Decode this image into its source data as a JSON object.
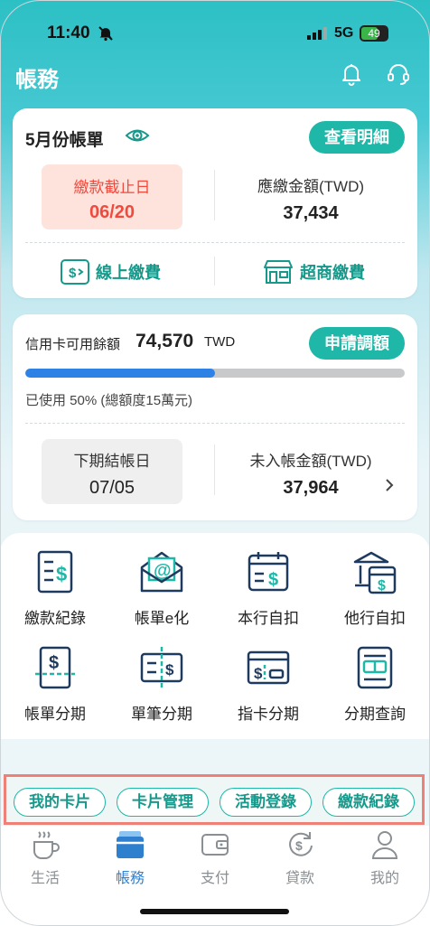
{
  "status_bar": {
    "time": "11:40",
    "network": "5G",
    "battery": "49"
  },
  "header": {
    "title": "帳務"
  },
  "bill": {
    "title": "5月份帳單",
    "detail_button": "查看明細",
    "due_label": "繳款截止日",
    "due_date": "06/20",
    "amount_label": "應繳金額(TWD)",
    "amount_value": "37,434",
    "online_pay": "線上繳費",
    "store_pay": "超商繳費"
  },
  "credit": {
    "available_label": "信用卡可用餘額",
    "available_value": "74,570",
    "currency": "TWD",
    "adjust_button": "申請調額",
    "used_fraction": 0.5,
    "used_text": "已使用 50% (總額度15萬元)",
    "next_close_label": "下期結帳日",
    "next_close_date": "07/05",
    "unbilled_label": "未入帳金額(TWD)",
    "unbilled_value": "37,964"
  },
  "functions": [
    {
      "label": "繳款紀錄",
      "icon": "payment-record-icon"
    },
    {
      "label": "帳單e化",
      "icon": "ebill-icon"
    },
    {
      "label": "本行自扣",
      "icon": "auto-debit-icon"
    },
    {
      "label": "他行自扣",
      "icon": "other-bank-debit-icon"
    },
    {
      "label": "帳單分期",
      "icon": "bill-installment-icon"
    },
    {
      "label": "單筆分期",
      "icon": "single-installment-icon"
    },
    {
      "label": "指卡分期",
      "icon": "card-installment-icon"
    },
    {
      "label": "分期查詢",
      "icon": "installment-query-icon"
    }
  ],
  "quick_links": [
    "我的卡片",
    "卡片管理",
    "活動登錄",
    "繳款紀錄"
  ],
  "tabs": [
    {
      "label": "生活",
      "icon": "coffee-icon"
    },
    {
      "label": "帳務",
      "icon": "card-stack-icon",
      "active": true
    },
    {
      "label": "支付",
      "icon": "wallet-icon"
    },
    {
      "label": "貸款",
      "icon": "loan-icon"
    },
    {
      "label": "我的",
      "icon": "person-icon"
    }
  ],
  "colors": {
    "accent": "#1fb7a7",
    "alert": "#f04a3e",
    "progress": "#2e82e6",
    "tab_active": "#2f7fcf"
  }
}
